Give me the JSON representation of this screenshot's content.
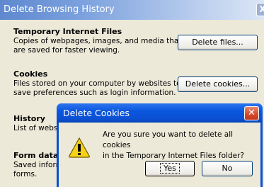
{
  "window": {
    "title": "Delete Browsing History",
    "close_label": "X"
  },
  "sections": {
    "temp_files": {
      "title": "Temporary Internet Files",
      "desc_line1": "Copies of webpages, images, and media that",
      "desc_line2": "are saved for faster viewing.",
      "button": "Delete files..."
    },
    "cookies": {
      "title": "Cookies",
      "desc_line1": "Files stored on your computer by websites to",
      "desc_line2": "save preferences such as login information.",
      "button": "Delete cookies..."
    },
    "history": {
      "title": "History",
      "desc_line1": "List of websit"
    },
    "form_data": {
      "title": "Form data",
      "desc_line1": "Saved inform",
      "desc_line2": "forms."
    }
  },
  "dialog": {
    "title": "Delete Cookies",
    "close_label": "✕",
    "message_line1": "Are you sure you want to delete all cookies",
    "message_line2": "in the Temporary Internet Files folder?",
    "yes_button": "Yes",
    "no_button": "No",
    "icon": "warning-icon"
  },
  "colors": {
    "window_face": "#ece9d8",
    "dialog_title": "#0a57df",
    "close_red": "#d5472a"
  }
}
